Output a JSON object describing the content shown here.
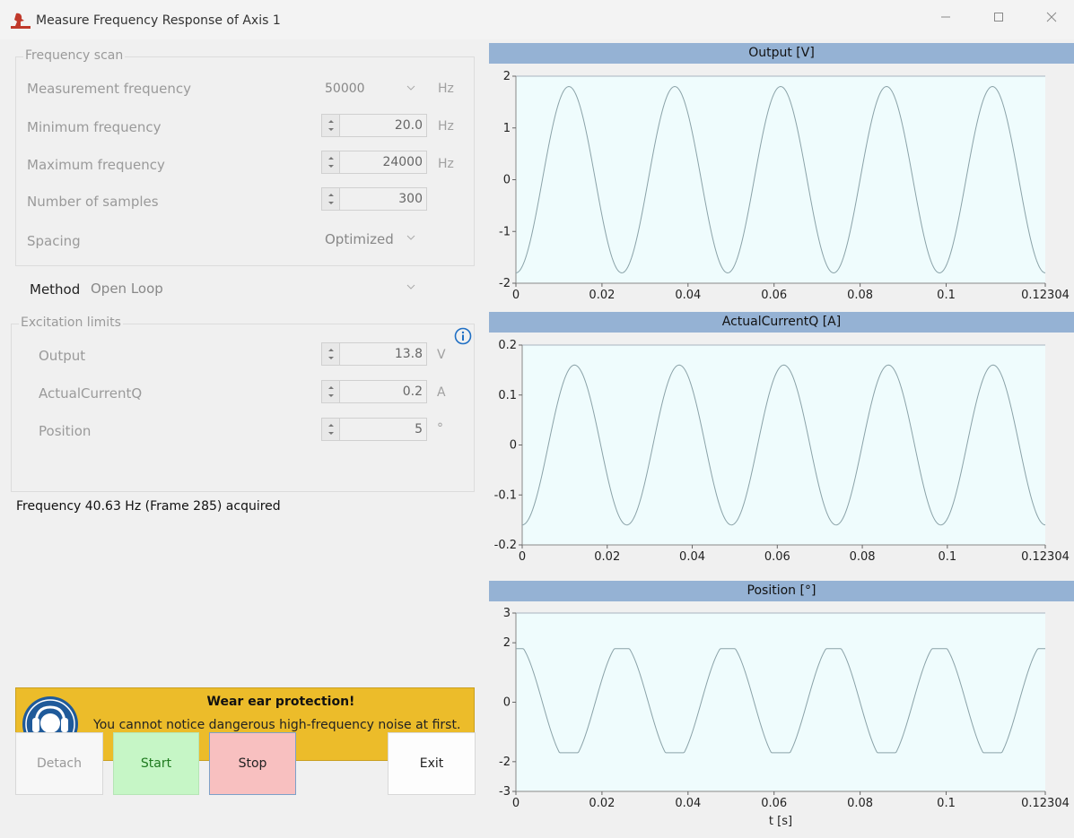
{
  "window": {
    "title": "Measure Frequency Response of Axis 1",
    "minimize_icon": "minimize-icon",
    "maximize_icon": "maximize-icon",
    "close_icon": "close-icon"
  },
  "frequency_scan": {
    "title": "Frequency scan",
    "measurement_frequency": {
      "label": "Measurement frequency",
      "value": "50000",
      "unit": "Hz"
    },
    "minimum_frequency": {
      "label": "Minimum frequency",
      "value": "20.0",
      "unit": "Hz"
    },
    "maximum_frequency": {
      "label": "Maximum frequency",
      "value": "24000",
      "unit": "Hz"
    },
    "number_of_samples": {
      "label": "Number of samples",
      "value": "300"
    },
    "spacing": {
      "label": "Spacing",
      "value": "Optimized"
    }
  },
  "method": {
    "label": "Method",
    "value": "Open Loop"
  },
  "excitation_limits": {
    "title": "Excitation limits",
    "info_icon": "info-icon",
    "output": {
      "label": "Output",
      "value": "13.8",
      "unit": "V"
    },
    "actual_current_q": {
      "label": "ActualCurrentQ",
      "value": "0.2",
      "unit": "A"
    },
    "position": {
      "label": "Position",
      "value": "5",
      "unit": "°"
    }
  },
  "status": "Frequency 40.63 Hz (Frame 285) acquired",
  "warning": {
    "title": "Wear ear protection!",
    "text": "You cannot notice dangerous high-frequency noise at first.",
    "icon": "ear-protection-icon",
    "color": "#ecbc2a"
  },
  "buttons": {
    "detach": "Detach",
    "start": "Start",
    "stop": "Stop",
    "exit": "Exit"
  },
  "colors": {
    "plot_bg": "#effcfd",
    "header_bg": "#95b2d4",
    "trace": "#8aa2a8"
  },
  "chart_data": [
    {
      "type": "line",
      "title": "Output [V]",
      "xlabel": "",
      "x_ticks": [
        "0",
        "0.02",
        "0.04",
        "0.06",
        "0.08",
        "0.1",
        "0.12304"
      ],
      "y_ticks": [
        "-2",
        "-1",
        "0",
        "1",
        "2"
      ],
      "xlim": [
        0,
        0.12304
      ],
      "ylim": [
        -2,
        2
      ],
      "series": [
        {
          "shape": "sine",
          "amplitude": 1.8,
          "frequency_hz": 40.63,
          "phase_deg": -90
        }
      ]
    },
    {
      "type": "line",
      "title": "ActualCurrentQ [A]",
      "xlabel": "",
      "x_ticks": [
        "0",
        "0.02",
        "0.04",
        "0.06",
        "0.08",
        "0.1",
        "0.12304"
      ],
      "y_ticks": [
        "-0.2",
        "-0.1",
        "0",
        "0.1",
        "0.2"
      ],
      "xlim": [
        0,
        0.12304
      ],
      "ylim": [
        -0.2,
        0.2
      ],
      "series": [
        {
          "shape": "sine",
          "amplitude": 0.16,
          "frequency_hz": 40.63,
          "phase_deg": -90
        }
      ]
    },
    {
      "type": "line",
      "title": "Position [°]",
      "xlabel": "t [s]",
      "x_ticks": [
        "0",
        "0.02",
        "0.04",
        "0.06",
        "0.08",
        "0.1",
        "0.12304"
      ],
      "y_ticks": [
        "-3",
        "-2",
        "0",
        "2",
        "3"
      ],
      "xlim": [
        0,
        0.12304
      ],
      "ylim": [
        -3,
        3
      ],
      "series": [
        {
          "shape": "clipped-sine",
          "amplitude": 2.0,
          "frequency_hz": 40.63,
          "phase_deg": 90
        }
      ]
    }
  ]
}
